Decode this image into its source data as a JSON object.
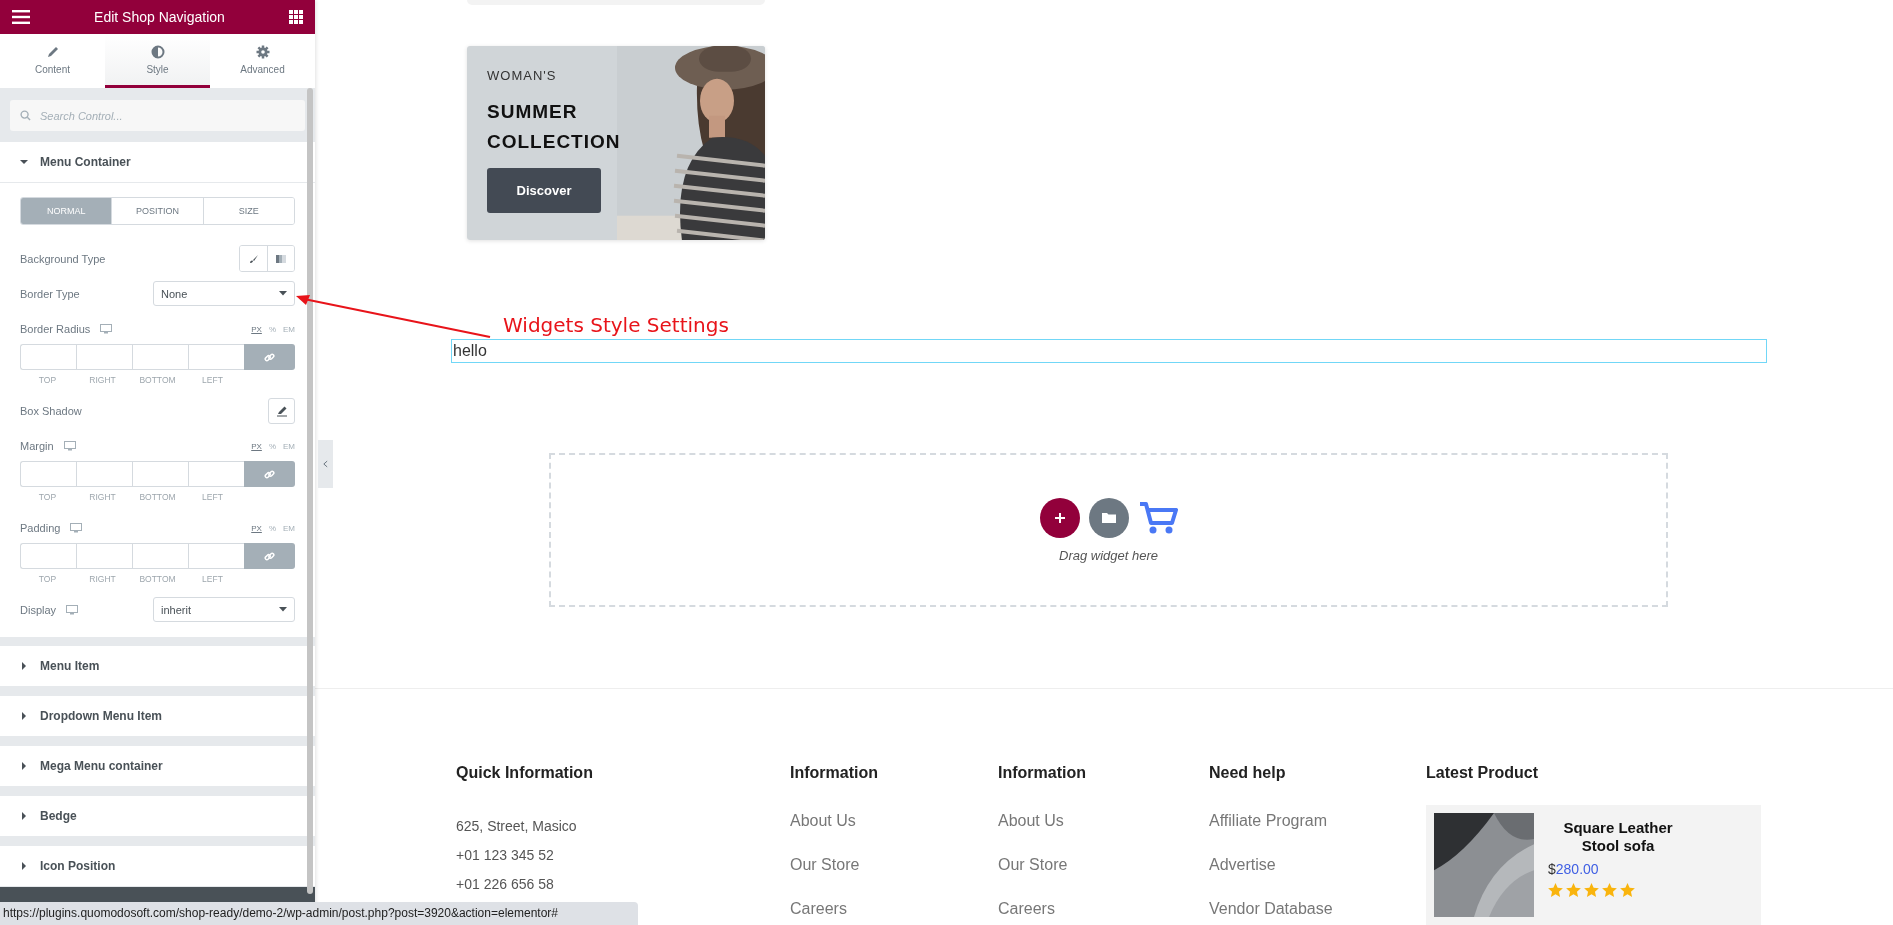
{
  "panel": {
    "title": "Edit Shop Navigation",
    "tabs": [
      {
        "label": "Content",
        "selected": false
      },
      {
        "label": "Style",
        "selected": true
      },
      {
        "label": "Advanced",
        "selected": false
      }
    ],
    "search": {
      "placeholder": "Search Control..."
    },
    "sections": [
      {
        "title": "Menu Container",
        "expanded": true,
        "state_tabs": [
          {
            "label": "NORMAL",
            "selected": true
          },
          {
            "label": "POSITION",
            "selected": false
          },
          {
            "label": "SIZE",
            "selected": false
          }
        ],
        "controls": [
          {
            "kind": "choice",
            "label": "Background Type",
            "responsive": false
          },
          {
            "kind": "select",
            "label": "Border Type",
            "value": "None",
            "responsive": false
          },
          {
            "kind": "dimensions",
            "label": "Border Radius",
            "responsive": true,
            "units": [
              {
                "label": "PX",
                "selected": true
              },
              {
                "label": "%",
                "selected": false
              },
              {
                "label": "EM",
                "selected": false
              }
            ],
            "sides": [
              "TOP",
              "RIGHT",
              "BOTTOM",
              "LEFT"
            ]
          },
          {
            "kind": "popover",
            "label": "Box Shadow",
            "responsive": false
          },
          {
            "kind": "dimensions",
            "label": "Margin",
            "responsive": true,
            "units": [
              {
                "label": "PX",
                "selected": true
              },
              {
                "label": "%",
                "selected": false
              },
              {
                "label": "EM",
                "selected": false
              }
            ],
            "sides": [
              "TOP",
              "RIGHT",
              "BOTTOM",
              "LEFT"
            ]
          },
          {
            "kind": "dimensions",
            "label": "Padding",
            "responsive": true,
            "units": [
              {
                "label": "PX",
                "selected": true
              },
              {
                "label": "%",
                "selected": false
              },
              {
                "label": "EM",
                "selected": false
              }
            ],
            "sides": [
              "TOP",
              "RIGHT",
              "BOTTOM",
              "LEFT"
            ]
          },
          {
            "kind": "select",
            "label": "Display",
            "value": "inherit",
            "responsive": true
          }
        ]
      },
      {
        "title": "Menu Item",
        "expanded": false
      },
      {
        "title": "Dropdown Menu Item",
        "expanded": false
      },
      {
        "title": "Mega Menu container",
        "expanded": false
      },
      {
        "title": "Bedge",
        "expanded": false
      },
      {
        "title": "Icon Position",
        "expanded": false
      }
    ]
  },
  "canvas": {
    "banner": {
      "kicker": "WOMAN'S",
      "title_lines": [
        "SUMMER",
        "COLLECTION"
      ],
      "button": "Discover"
    },
    "annotation": {
      "text": "Widgets Style Settings"
    },
    "text_widget": {
      "value": "hello"
    },
    "drop_zone": {
      "hint": "Drag widget here"
    },
    "footer": {
      "columns": [
        {
          "kind": "contact",
          "heading": "Quick Information",
          "items": [
            "625, Street, Masico",
            "+01 123 345 52",
            "+01 226 656 58"
          ]
        },
        {
          "kind": "links",
          "heading": "Information",
          "items": [
            "About Us",
            "Our Store",
            "Careers"
          ]
        },
        {
          "kind": "links",
          "heading": "Information",
          "items": [
            "About Us",
            "Our Store",
            "Careers"
          ]
        },
        {
          "kind": "links",
          "heading": "Need help",
          "items": [
            "Affiliate Program",
            "Advertise",
            "Vendor Database"
          ]
        }
      ],
      "latest": {
        "heading": "Latest Product",
        "product": {
          "name": "Square Leather Stool sofa",
          "currency": "$",
          "price": "280.00",
          "stars": 5
        }
      }
    }
  },
  "status_bar": {
    "url": "https://plugins.quomodosoft.com/shop-ready/demo-2/wp-admin/post.php?post=3920&action=elementor#"
  }
}
